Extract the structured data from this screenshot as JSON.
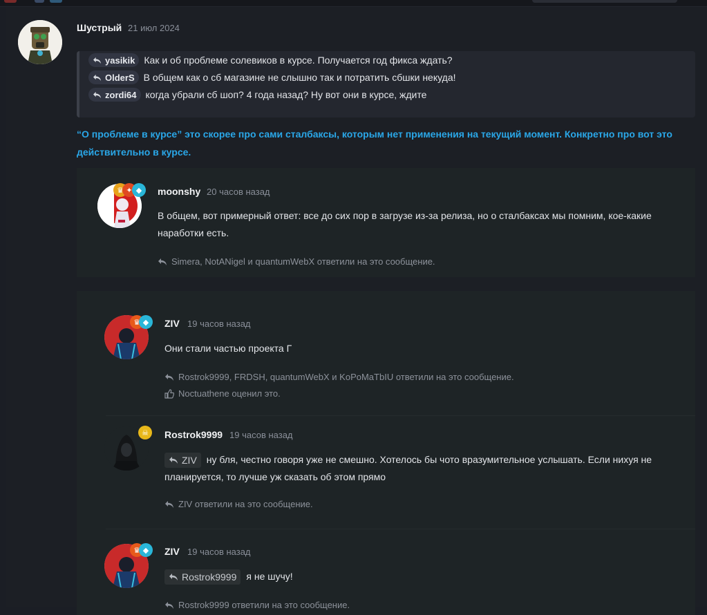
{
  "main_post": {
    "author": "Шустрый",
    "date": "21 июл 2024",
    "quotes": [
      {
        "user": "yasikik",
        "text": "Как и об проблеме солевиков в курсе. Получается год фикса ждать?"
      },
      {
        "user": "OlderS",
        "text": "В общем как о сб магазине не слышно так и потратить сбшки некуда!"
      },
      {
        "user": "zordi64",
        "text": "когда убрали сб шоп? 4 года назад? Ну вот они в курсе, ждите"
      }
    ],
    "highlight": "“О проблеме в курсе” это скорее про сами сталбаксы, которым нет применения на текущий момент. Конкретно про вот это действительно в курсе."
  },
  "reply_moonshy": {
    "author": "moonshy",
    "time": "20 часов назад",
    "text": "В общем, вот примерный ответ: все до сих пор в загрузе из-за релиза, но о сталбаксах мы помним, кое-какие наработки есть.",
    "replied": "Simera, NotANigel и quantumWebX ответили на это сообщение."
  },
  "reply_ziv1": {
    "author": "ZIV",
    "time": "19 часов назад",
    "text": "Они стали частью проекта Г",
    "replied": "Rostrok9999, FRDSH, quantumWebX и KoPoMaTbIU ответили на это сообщение.",
    "liked": "Noctuathene оценил это."
  },
  "reply_rostrok": {
    "author": "Rostrok9999",
    "time": "19 часов назад",
    "mention": "ZIV",
    "text": "ну бля, честно говоря уже не смешно. Хотелось бы чото вразумительное услышать. Если нихуя не планируется, то лучше уж сказать об этом прямо",
    "replied": "ZIV ответили на это сообщение."
  },
  "reply_ziv2": {
    "author": "ZIV",
    "time": "19 часов назад",
    "mention": "Rostrok9999",
    "text": "я не шучу!",
    "replied": "Rostrok9999 ответили на это сообщение."
  },
  "colors": {
    "background": "#1b1e25",
    "panel": "#1e2426",
    "accent_blue": "#2aa7e8",
    "muted": "#8a8f99"
  },
  "icons": [
    "reply-arrow-icon",
    "like-thumb-icon",
    "trophy-badge-icon",
    "diamond-badge-icon",
    "skull-badge-icon"
  ]
}
